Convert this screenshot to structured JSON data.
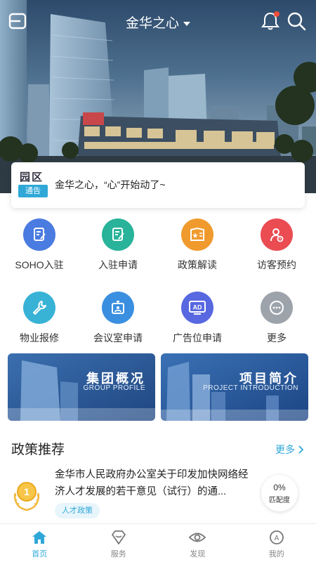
{
  "header": {
    "title": "金华之心",
    "menu_icon": "menu-icon",
    "bell_icon": "bell-icon",
    "search_icon": "search-icon"
  },
  "notice": {
    "badge_top": "园区",
    "badge_bottom": "通告",
    "text": "金华之心，“心”开始动了~"
  },
  "services": [
    {
      "label": "SOHO入驻",
      "icon": "document-edit-icon",
      "color": "#4a7be0"
    },
    {
      "label": "入驻申请",
      "icon": "form-edit-icon",
      "color": "#28b39a"
    },
    {
      "label": "政策解读",
      "icon": "policy-star-icon",
      "color": "#f09a2e"
    },
    {
      "label": "访客预约",
      "icon": "visitor-icon",
      "color": "#ea4c52"
    },
    {
      "label": "物业报修",
      "icon": "wrench-icon",
      "color": "#38b3d6"
    },
    {
      "label": "会议室申请",
      "icon": "meeting-room-icon",
      "color": "#3b8fe0"
    },
    {
      "label": "广告位申请",
      "icon": "ad-icon",
      "color": "#5868e0"
    },
    {
      "label": "更多",
      "icon": "more-icon",
      "color": "#9da3ab"
    }
  ],
  "banners": [
    {
      "title": "集团概况",
      "subtitle": "GROUP PROFILE"
    },
    {
      "title": "项目简介",
      "subtitle": "PROJECT INTRODUCTION"
    }
  ],
  "policy": {
    "section_title": "政策推荐",
    "more_label": "更多",
    "item_text": "金华市人民政府办公室关于印发加快网络经济人才发展的若干意见（试行）的通...",
    "tag": "人才政策",
    "rank": "1",
    "match_percent": "0%",
    "match_label": "匹配度"
  },
  "bottom_nav": [
    {
      "label": "首页",
      "icon": "home-icon",
      "active": true
    },
    {
      "label": "服务",
      "icon": "service-icon",
      "active": false
    },
    {
      "label": "发现",
      "icon": "eye-icon",
      "active": false
    },
    {
      "label": "我的",
      "icon": "profile-icon",
      "active": false
    }
  ],
  "colors": {
    "accent": "#2fa8d8",
    "badge_dot": "#f04d3a"
  }
}
